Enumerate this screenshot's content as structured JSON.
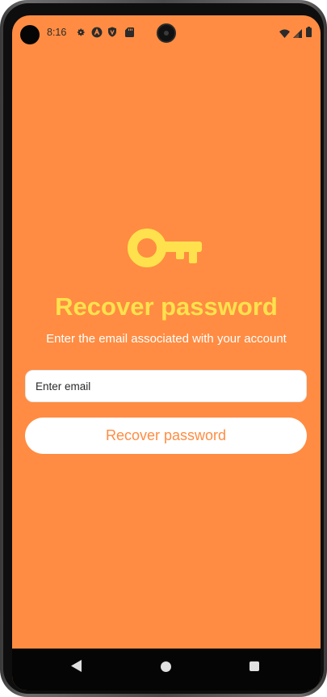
{
  "status_bar": {
    "time": "8:16",
    "icons": [
      "settings-icon",
      "a-badge-icon",
      "shield-icon",
      "sd-card-icon",
      "wifi-icon",
      "signal-icon",
      "battery-icon"
    ]
  },
  "recover": {
    "icon": "key-icon",
    "title": "Recover password",
    "subtitle": "Enter the email associated with your account",
    "email_placeholder": "Enter email",
    "email_value": "",
    "button_label": "Recover password"
  },
  "nav_bar": {
    "icons": [
      "back-icon",
      "home-icon",
      "recents-icon"
    ]
  },
  "colors": {
    "background": "#ff8c42",
    "title": "#ffe14d",
    "button_text": "#ff8c42",
    "surface": "#ffffff"
  }
}
